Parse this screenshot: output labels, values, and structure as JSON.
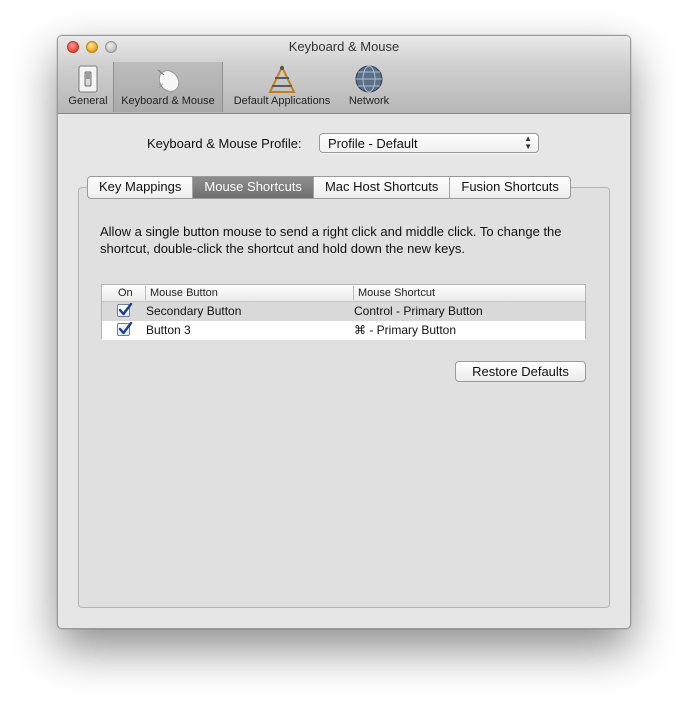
{
  "window": {
    "title": "Keyboard & Mouse"
  },
  "toolbar": {
    "items": [
      {
        "label": "General",
        "icon": "light-switch-icon"
      },
      {
        "label": "Keyboard & Mouse",
        "icon": "mouse-icon",
        "selected": true
      },
      {
        "label": "Default Applications",
        "icon": "app-tools-icon"
      },
      {
        "label": "Network",
        "icon": "globe-icon"
      }
    ]
  },
  "profile": {
    "label": "Keyboard & Mouse Profile:",
    "value": "Profile - Default"
  },
  "tabs": [
    {
      "label": "Key Mappings"
    },
    {
      "label": "Mouse Shortcuts",
      "selected": true
    },
    {
      "label": "Mac Host Shortcuts"
    },
    {
      "label": "Fusion Shortcuts"
    }
  ],
  "description": "Allow a single button mouse to send a right click and middle click. To change the shortcut, double-click the shortcut and hold down the new keys.",
  "table": {
    "headers": [
      "On",
      "Mouse Button",
      "Mouse Shortcut"
    ],
    "rows": [
      {
        "on": true,
        "button": "Secondary Button",
        "shortcut": "Control - Primary Button"
      },
      {
        "on": true,
        "button": "Button 3",
        "shortcut": "⌘ - Primary Button"
      }
    ]
  },
  "restore_button": "Restore Defaults",
  "colors": {
    "selected_tab": "#7a7a7a",
    "checkbox_check": "#1b3f8b"
  }
}
